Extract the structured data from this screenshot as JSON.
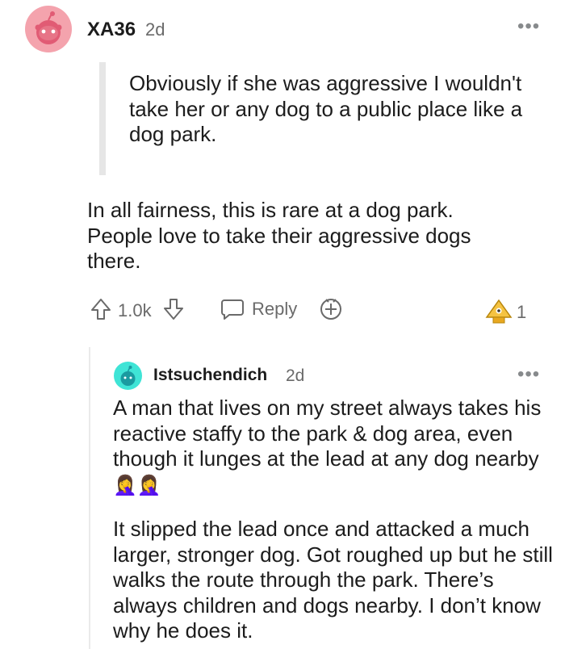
{
  "comment1": {
    "author": "XA36",
    "age": "2d",
    "avatar_color": "#f4a3ad",
    "quote": "Obviously if she was aggressive I wouldn't take her or any dog to a public place like a dog park.",
    "body": "In all fairness, this is rare at a dog park. People love to take their aggressive dogs there.",
    "votes": "1.0k",
    "reply_label": "Reply",
    "award_count": "1"
  },
  "comment2": {
    "author": "Istsuchendich",
    "age": "2d",
    "avatar_color": "#3fe4d6",
    "para1": "A man that lives on my street always takes his reactive staffy to the park & dog area, even though it lunges at the lead at any dog nearby",
    "emoji": "🤦‍♀️🤦‍♀️",
    "para2": "It slipped the lead once and attacked a much larger, stronger dog. Got roughed up but he still walks the route through the park. There’s always children and dogs nearby. I don’t know why he does it."
  }
}
